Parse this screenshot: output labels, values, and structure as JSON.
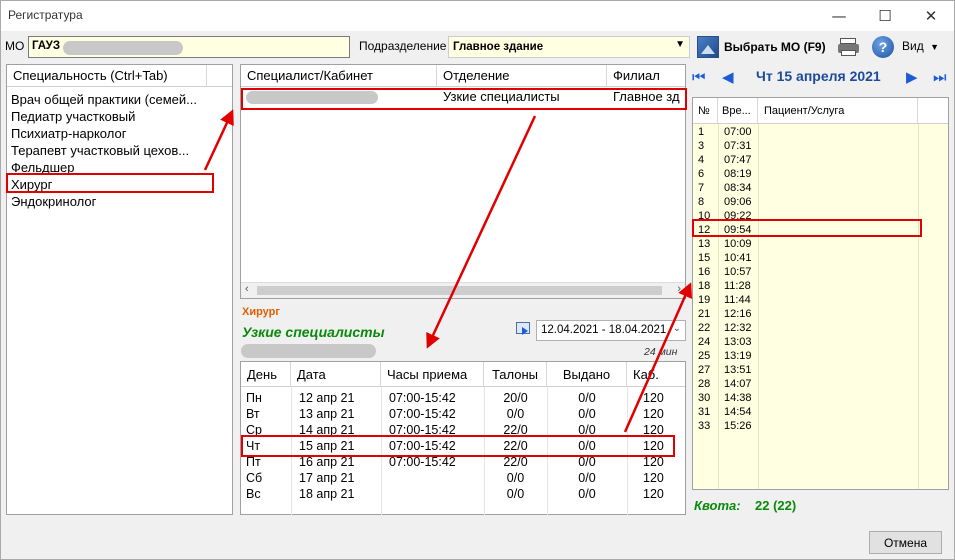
{
  "window": {
    "title": "Регистратура",
    "minimize": "—",
    "maximize": "☐",
    "close": "✕"
  },
  "toolbar": {
    "mo_label": "МО",
    "mo_value": "ГАУЗ",
    "division_label": "Подразделение",
    "division_value": "Главное здание",
    "select_mo_label": "Выбрать МО (F9)",
    "view_label": "Вид"
  },
  "specialties": {
    "header": "Специальность (Ctrl+Tab)",
    "items": [
      "Врач общей практики (семей...",
      "Педиатр участковый",
      "Психиатр-нарколог",
      "Терапевт участковый цехов...",
      "Фельдшер",
      "Хирург",
      "Эндокринолог"
    ]
  },
  "specialists": {
    "headers": [
      "Специалист/Кабинет",
      "Отделение",
      "Филиал"
    ],
    "rows": [
      {
        "dept": "Узкие специалисты",
        "branch": "Главное зд"
      }
    ]
  },
  "details": {
    "specialty": "Хирург",
    "dept": "Узкие специалисты",
    "date_range": "12.04.2021 - 18.04.2021",
    "duration": "24 мин"
  },
  "schedule": {
    "headers": [
      "День",
      "Дата",
      "Часы приема",
      "Талоны",
      "Выдано",
      "Каб."
    ],
    "rows": [
      [
        "Пн",
        "12 апр 21",
        "07:00-15:42",
        "20/0",
        "0/0",
        "120"
      ],
      [
        "Вт",
        "13 апр 21",
        "07:00-15:42",
        "0/0",
        "0/0",
        "120"
      ],
      [
        "Ср",
        "14 апр 21",
        "07:00-15:42",
        "22/0",
        "0/0",
        "120"
      ],
      [
        "Чт",
        "15 апр 21",
        "07:00-15:42",
        "22/0",
        "0/0",
        "120"
      ],
      [
        "Пт",
        "16 апр 21",
        "07:00-15:42",
        "22/0",
        "0/0",
        "120"
      ],
      [
        "Сб",
        "17 апр 21",
        "",
        "0/0",
        "0/0",
        "120"
      ],
      [
        "Вс",
        "18 апр 21",
        "",
        "0/0",
        "0/0",
        "120"
      ]
    ]
  },
  "calendar": {
    "date_label": "Чт 15 апреля 2021"
  },
  "slots": {
    "headers": [
      "№",
      "Вре...",
      "Пациент/Услуга"
    ],
    "rows": [
      [
        "1",
        "07:00"
      ],
      [
        "3",
        "07:31"
      ],
      [
        "4",
        "07:47"
      ],
      [
        "6",
        "08:19"
      ],
      [
        "7",
        "08:34"
      ],
      [
        "8",
        "09:06"
      ],
      [
        "10",
        "09:22"
      ],
      [
        "12",
        "09:54"
      ],
      [
        "13",
        "10:09"
      ],
      [
        "15",
        "10:41"
      ],
      [
        "16",
        "10:57"
      ],
      [
        "18",
        "11:28"
      ],
      [
        "19",
        "11:44"
      ],
      [
        "21",
        "12:16"
      ],
      [
        "22",
        "12:32"
      ],
      [
        "24",
        "13:03"
      ],
      [
        "25",
        "13:19"
      ],
      [
        "27",
        "13:51"
      ],
      [
        "28",
        "14:07"
      ],
      [
        "30",
        "14:38"
      ],
      [
        "31",
        "14:54"
      ],
      [
        "33",
        "15:26"
      ]
    ]
  },
  "quota": {
    "label": "Квота:",
    "value": "22 (22)"
  },
  "footer": {
    "cancel": "Отмена"
  },
  "colors": {
    "highlight": "#e00000",
    "field_bg": "#ffffe1",
    "accent_green": "#0a8a0a",
    "accent_orange": "#e06000"
  }
}
